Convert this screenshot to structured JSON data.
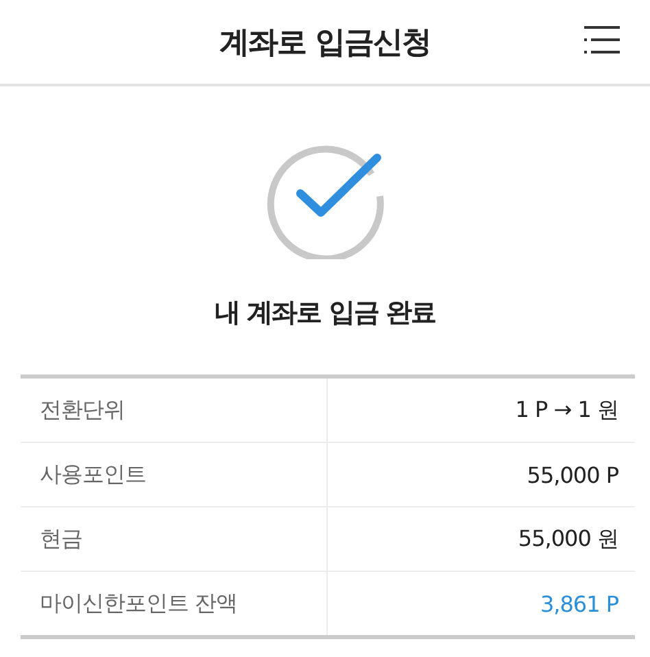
{
  "header": {
    "title": "계좌로 입금신청"
  },
  "result": {
    "message": "내 계좌로 입금 완료"
  },
  "details": [
    {
      "label": "전환단위",
      "value": "1 P → 1 원",
      "highlighted": false
    },
    {
      "label": "사용포인트",
      "value": "55,000 P",
      "highlighted": false
    },
    {
      "label": "현금",
      "value": "55,000 원",
      "highlighted": false
    },
    {
      "label": "마이신한포인트 잔액",
      "value": "3,861 P",
      "highlighted": true
    }
  ]
}
